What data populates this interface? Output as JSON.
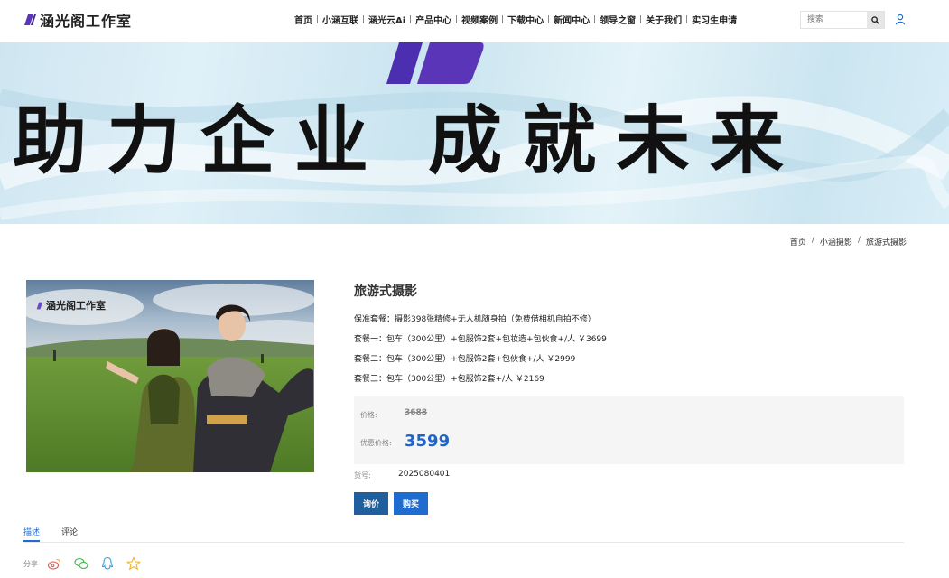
{
  "header": {
    "logo_text": "涵光阁工作室",
    "nav": [
      {
        "label": "首页"
      },
      {
        "label": "小涵互联"
      },
      {
        "label": "涵光云Ai"
      },
      {
        "label": "产品中心"
      },
      {
        "label": "视频案例"
      },
      {
        "label": "下载中心"
      },
      {
        "label": "新闻中心"
      },
      {
        "label": "领导之窗"
      },
      {
        "label": "关于我们"
      },
      {
        "label": "实习生申请"
      }
    ],
    "search_placeholder": "搜索"
  },
  "banner": {
    "text_left": "助力企业",
    "text_right": "成就未来"
  },
  "breadcrumb": [
    "首页",
    "小涵摄影",
    "旅游式摄影"
  ],
  "product": {
    "image_watermark": "涵光阁工作室",
    "title": "旅游式摄影",
    "packages": [
      "保准套餐：摄影398张精修+无人机随身拍（免费借相机自拍不修）",
      "套餐一：包车（300公里）+包服饰2套+包妆造+包伙食+/人 ￥3699",
      "套餐二：包车（300公里）+包服饰2套+包伙食+/人 ￥2999",
      "套餐三：包车（300公里）+包服饰2套+/人 ￥2169"
    ],
    "price_label": "价格:",
    "original_price": "3688",
    "sale_price_label": "优惠价格:",
    "sale_price": "3599",
    "sku_label": "货号:",
    "sku_value": "2025080401",
    "inquiry_label": "询价",
    "buy_label": "购买"
  },
  "tabs": [
    {
      "label": "描述",
      "active": true
    },
    {
      "label": "评论",
      "active": false
    }
  ],
  "share": {
    "label": "分享",
    "icons": [
      "weibo-icon",
      "wechat-icon",
      "qq-icon",
      "qzone-icon"
    ]
  },
  "colors": {
    "accent": "#1f6cd0",
    "inquiry_button": "#1f5f9e",
    "logo_purple": "#5a35b8",
    "price_box": "#f5f5f5"
  }
}
